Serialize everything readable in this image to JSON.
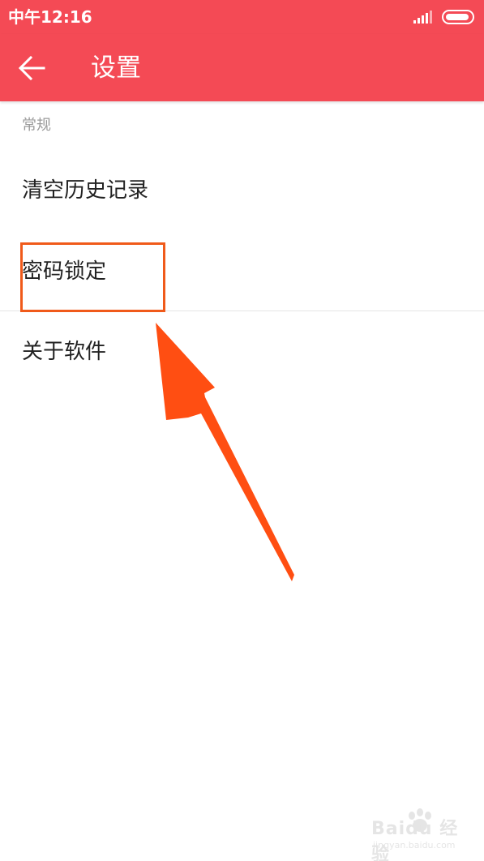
{
  "status_bar": {
    "time": "中午12:16",
    "signal_icon": "signal-bars-icon",
    "battery_icon": "battery-icon"
  },
  "app_bar": {
    "back_icon": "arrow-left-icon",
    "title": "设置"
  },
  "settings": {
    "section_header": "常规",
    "items": [
      {
        "label": "清空历史记录"
      },
      {
        "label": "密码锁定"
      },
      {
        "label": "关于软件"
      }
    ]
  },
  "annotation": {
    "highlight_color": "#f05a1a",
    "arrow_color": "#ff4e12"
  },
  "watermark": {
    "brand": "Baidu 经验",
    "url": "jingyan.baidu.com"
  },
  "theme": {
    "accent": "#f44a55",
    "text_primary": "#222222",
    "text_secondary": "#9a9a9a"
  }
}
